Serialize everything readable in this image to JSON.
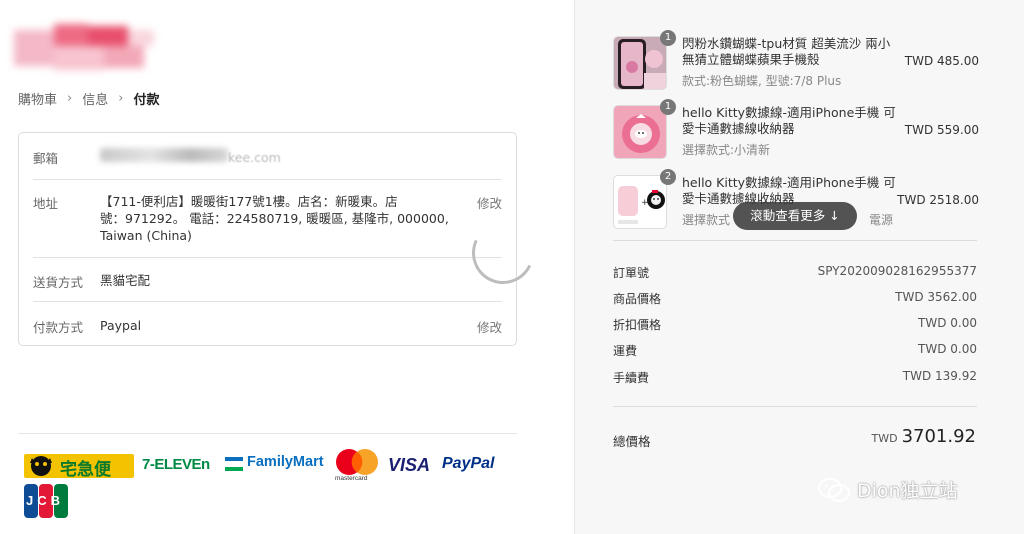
{
  "breadcrumb": {
    "cart": "購物車",
    "info": "信息",
    "payment": "付款",
    "sep": "›"
  },
  "contact": {
    "label": "郵箱",
    "suffix": "kee.com"
  },
  "address": {
    "label": "地址",
    "line1": "【711-便利店】暖暖街177號1樓。店名：新暖東。店",
    "line2": "號：971292。 電話：224580719, 暖暖區, 基隆市, 000000,",
    "line3": "Taiwan (China)",
    "edit": "修改"
  },
  "shipping": {
    "label": "送貨方式",
    "value": "黑貓宅配"
  },
  "payment": {
    "label": "付款方式",
    "value": "Paypal",
    "edit": "修改"
  },
  "payment_logos": {
    "black_cat": "宅急便",
    "seven": "7-ELEVEn",
    "family": "FamilyMart",
    "mastercard": "mastercard",
    "visa": "VISA",
    "paypal": "PayPal",
    "jcb": "JCB"
  },
  "items": [
    {
      "qty": "1",
      "name1": "閃粉水鑽蝴蝶-tpu材質 超美流沙 兩小",
      "name2": "無猜立體蝴蝶蘋果手機殼",
      "variant": "款式:粉色蝴蝶, 型號:7/8 Plus",
      "price": "TWD 485.00"
    },
    {
      "qty": "1",
      "name1": "hello Kitty數據線-適用iPhone手機 可",
      "name2": "愛卡通數據線收納器",
      "variant": "選擇款式:小清新",
      "price": "TWD 559.00"
    },
    {
      "qty": "2",
      "name1": "hello Kitty數據線-適用iPhone手機 可",
      "name2": "愛卡通數據線收納器",
      "variant": "選擇款式",
      "variant_tail": "電源",
      "price": "TWD 2518.00"
    }
  ],
  "scroll_hint": "滾動查看更多 ↓",
  "summary": [
    {
      "label": "訂單號",
      "value": "SPY202009028162955377"
    },
    {
      "label": "商品價格",
      "value": "TWD 3562.00"
    },
    {
      "label": "折扣價格",
      "value": "TWD 0.00"
    },
    {
      "label": "運費",
      "value": "TWD 0.00"
    },
    {
      "label": "手續費",
      "value": "TWD 139.92"
    }
  ],
  "total": {
    "label": "總價格",
    "currency": "TWD",
    "amount": "3701.92"
  },
  "watermark": "Dion独立站",
  "colors": {
    "right_bg": "#f7f7f7",
    "badge": "#777777",
    "mastercard_red": "#eb001b",
    "mastercard_yellow": "#f79e1b",
    "visa_blue": "#1a1f71",
    "paypal_blue": "#003087",
    "seven_green": "#008a45",
    "family_blue": "#0a6fbf"
  }
}
